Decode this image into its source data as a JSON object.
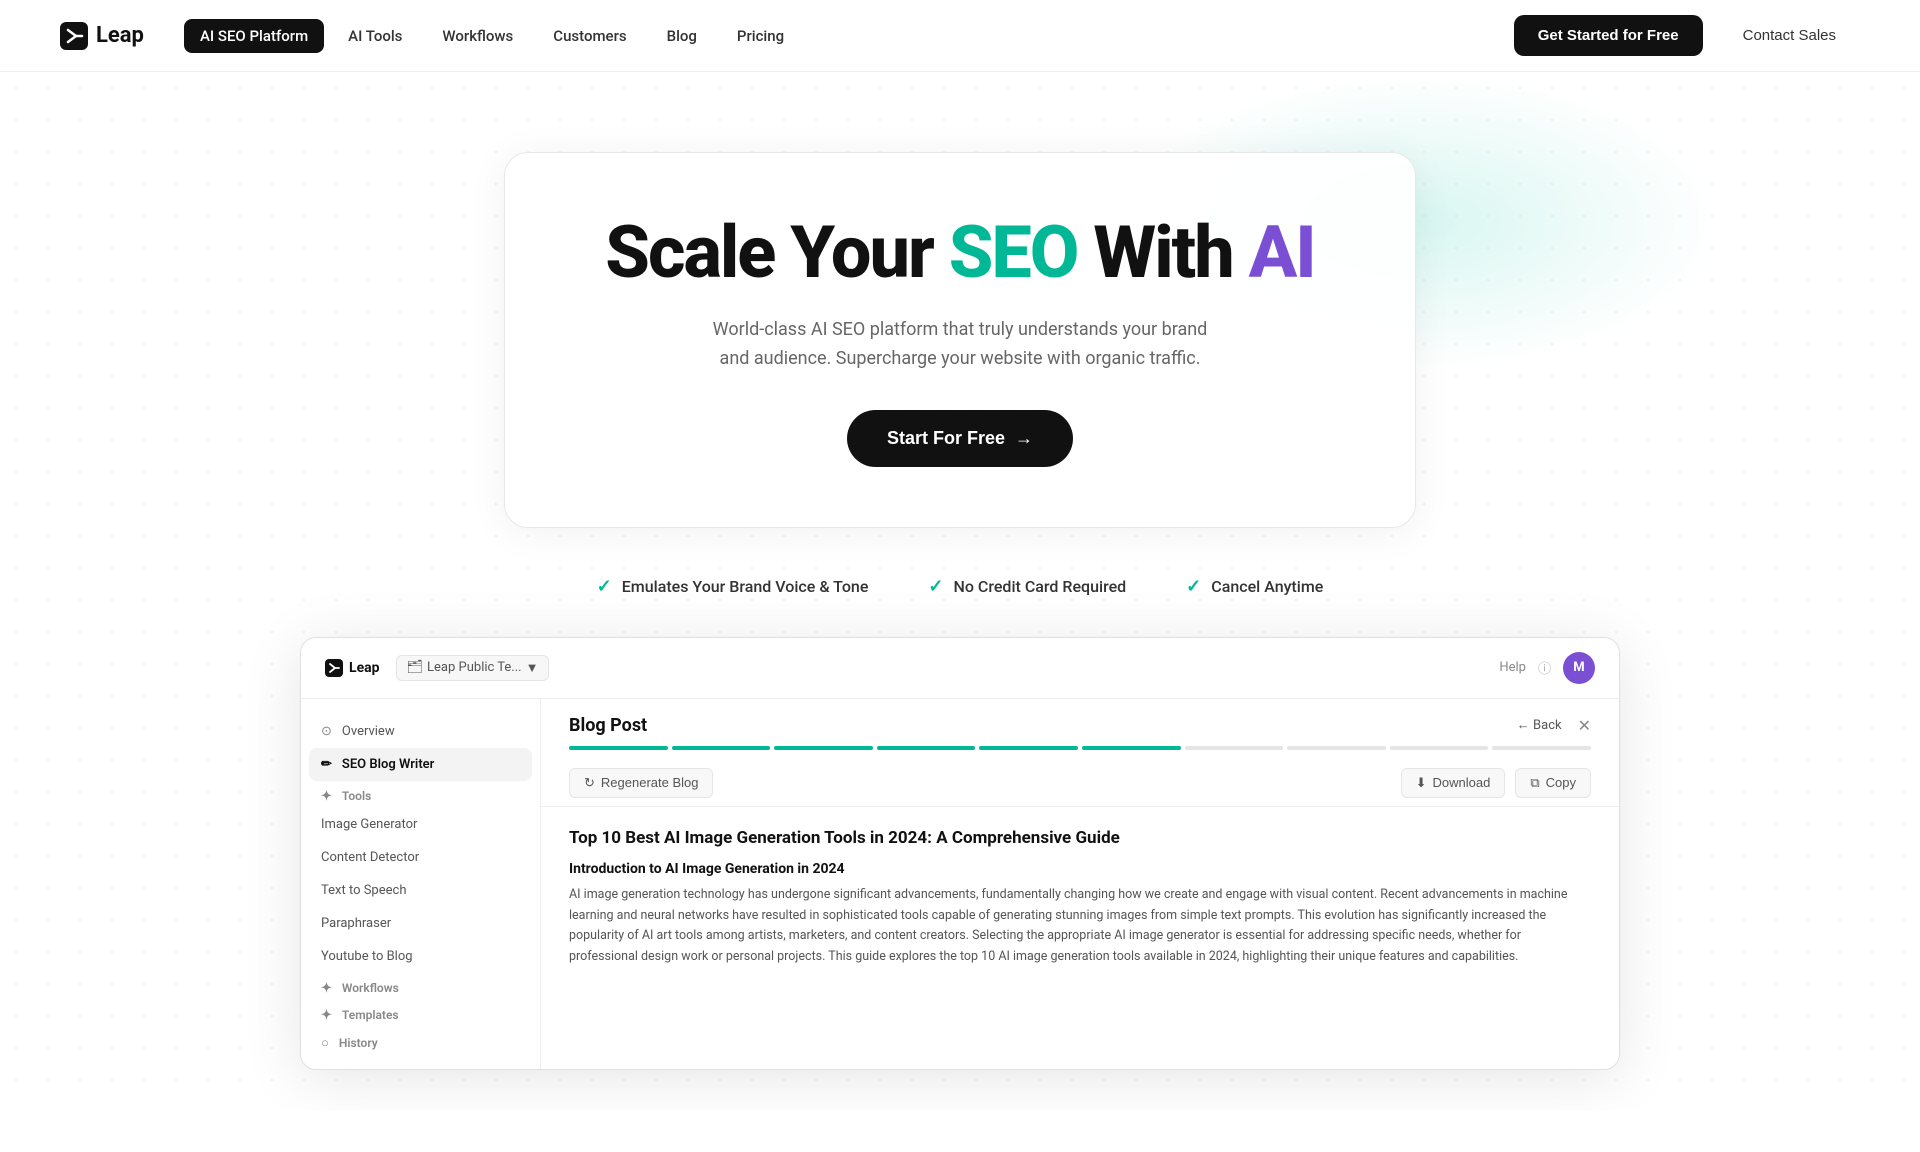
{
  "navbar": {
    "logo_text": "Leap",
    "nav_items": [
      {
        "label": "AI SEO Platform",
        "active": true
      },
      {
        "label": "AI Tools",
        "active": false
      },
      {
        "label": "Workflows",
        "active": false
      },
      {
        "label": "Customers",
        "active": false
      },
      {
        "label": "Blog",
        "active": false
      },
      {
        "label": "Pricing",
        "active": false
      }
    ],
    "cta_label": "Get Started for Free",
    "contact_label": "Contact Sales"
  },
  "hero": {
    "title_part1": "Scale Your ",
    "title_seo": "SEO",
    "title_part2": " With ",
    "title_ai": "AI",
    "subtitle": "World-class AI SEO platform that truly understands your brand and audience. Supercharge your website with organic traffic.",
    "cta_label": "Start For Free",
    "features": [
      "Emulates Your Brand Voice & Tone",
      "No Credit Card Required",
      "Cancel Anytime"
    ]
  },
  "app_screenshot": {
    "header": {
      "logo": "Leap",
      "breadcrumb": "Leap Public Te...",
      "breadcrumb_icon": "▼",
      "help_label": "Help",
      "avatar_label": "M"
    },
    "sidebar": {
      "items": [
        {
          "label": "Overview",
          "icon": "⊙",
          "active": false,
          "type": "item"
        },
        {
          "label": "SEO Blog Writer",
          "icon": "✏",
          "active": true,
          "type": "item"
        },
        {
          "label": "Tools",
          "icon": "✦",
          "active": false,
          "type": "section"
        },
        {
          "label": "Image Generator",
          "active": false,
          "type": "sub-item"
        },
        {
          "label": "Content Detector",
          "active": false,
          "type": "sub-item"
        },
        {
          "label": "Text to Speech",
          "active": false,
          "type": "sub-item"
        },
        {
          "label": "Paraphraser",
          "active": false,
          "type": "sub-item"
        },
        {
          "label": "Youtube to Blog",
          "active": false,
          "type": "sub-item"
        },
        {
          "label": "Workflows",
          "icon": "✦",
          "active": false,
          "type": "section"
        },
        {
          "label": "Templates",
          "icon": "✦",
          "active": false,
          "type": "section"
        },
        {
          "label": "History",
          "icon": "○",
          "active": false,
          "type": "section"
        }
      ]
    },
    "blog_post": {
      "title": "Blog Post",
      "back_label": "← Back",
      "close_label": "✕",
      "progress_tabs": [
        true,
        true,
        true,
        true,
        true,
        true,
        false,
        false,
        false,
        false
      ],
      "regenerate_label": "Regenerate Blog",
      "download_label": "Download",
      "copy_label": "Copy",
      "article_title": "Top 10 Best AI Image Generation Tools in 2024: A Comprehensive Guide",
      "section_title": "Introduction to AI Image Generation in 2024",
      "article_text": "AI image generation technology has undergone significant advancements, fundamentally changing how we create and engage with visual content. Recent advancements in machine learning and neural networks have resulted in sophisticated tools capable of generating stunning images from simple text prompts. This evolution has significantly increased the popularity of AI art tools among artists, marketers, and content creators. Selecting the appropriate AI image generator is essential for addressing specific needs, whether for professional design work or personal projects. This guide explores the top 10 AI image generation tools available in 2024, highlighting their unique features and capabilities."
    }
  }
}
